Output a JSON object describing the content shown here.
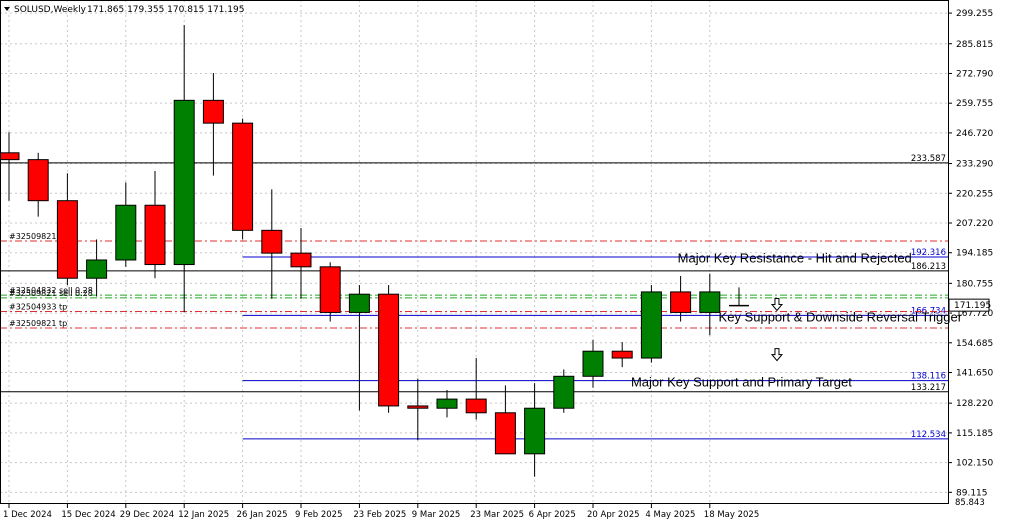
{
  "header": {
    "symbol": "SOLUSD,Weekly",
    "ohlc": "171.865 179.355 170.815 171.195"
  },
  "chart_data": {
    "type": "candlestick",
    "ylim": [
      84,
      305
    ],
    "y_ticks": [
      "299.255",
      "285.815",
      "272.790",
      "259.755",
      "246.720",
      "233.290",
      "220.255",
      "207.220",
      "194.185",
      "180.755",
      "167.720",
      "154.685",
      "141.650",
      "128.220",
      "115.185",
      "102.150",
      "89.115"
    ],
    "x_labels": [
      {
        "label": "1 Dec 2024",
        "index": 0
      },
      {
        "label": "15 Dec 2024",
        "index": 2
      },
      {
        "label": "29 Dec 2024",
        "index": 4
      },
      {
        "label": "12 Jan 2025",
        "index": 6
      },
      {
        "label": "26 Jan 2025",
        "index": 8
      },
      {
        "label": "9 Feb 2025",
        "index": 10
      },
      {
        "label": "23 Feb 2025",
        "index": 12
      },
      {
        "label": "9 Mar 2025",
        "index": 14
      },
      {
        "label": "23 Mar 2025",
        "index": 16
      },
      {
        "label": "6 Apr 2025",
        "index": 18
      },
      {
        "label": "20 Apr 2025",
        "index": 20
      },
      {
        "label": "4 May 2025",
        "index": 22
      },
      {
        "label": "18 May 2025",
        "index": 24
      }
    ],
    "candles": [
      {
        "o": 238,
        "h": 247,
        "l": 217,
        "c": 235
      },
      {
        "o": 235,
        "h": 238,
        "l": 210,
        "c": 217
      },
      {
        "o": 217,
        "h": 229,
        "l": 180,
        "c": 183
      },
      {
        "o": 183,
        "h": 200,
        "l": 175,
        "c": 191
      },
      {
        "o": 191,
        "h": 225,
        "l": 188,
        "c": 215
      },
      {
        "o": 215,
        "h": 230,
        "l": 183,
        "c": 189
      },
      {
        "o": 189,
        "h": 294,
        "l": 168,
        "c": 261
      },
      {
        "o": 261,
        "h": 273,
        "l": 228,
        "c": 251
      },
      {
        "o": 251,
        "h": 253,
        "l": 200,
        "c": 204
      },
      {
        "o": 204,
        "h": 222,
        "l": 174,
        "c": 194
      },
      {
        "o": 194,
        "h": 205,
        "l": 174,
        "c": 188
      },
      {
        "o": 188,
        "h": 190,
        "l": 164,
        "c": 168
      },
      {
        "o": 168,
        "h": 180,
        "l": 125,
        "c": 176
      },
      {
        "o": 176,
        "h": 180,
        "l": 124,
        "c": 127
      },
      {
        "o": 127,
        "h": 139,
        "l": 112,
        "c": 126
      },
      {
        "o": 126,
        "h": 134,
        "l": 122,
        "c": 130
      },
      {
        "o": 130,
        "h": 148,
        "l": 121,
        "c": 124
      },
      {
        "o": 124,
        "h": 136,
        "l": 106,
        "c": 106
      },
      {
        "o": 106,
        "h": 137,
        "l": 96,
        "c": 126
      },
      {
        "o": 126,
        "h": 143,
        "l": 124,
        "c": 140
      },
      {
        "o": 140,
        "h": 156,
        "l": 135,
        "c": 151
      },
      {
        "o": 151,
        "h": 155,
        "l": 144,
        "c": 148
      },
      {
        "o": 148,
        "h": 180,
        "l": 146,
        "c": 177
      },
      {
        "o": 177,
        "h": 184,
        "l": 164,
        "c": 168
      },
      {
        "o": 168,
        "h": 185,
        "l": 158,
        "c": 177
      },
      {
        "o": 172,
        "h": 179,
        "l": 171,
        "c": 171
      }
    ],
    "levels": [
      {
        "value": 233.587,
        "label": "233.587",
        "style": "black",
        "from_index": 0
      },
      {
        "value": 192.316,
        "label": "192.316",
        "style": "blue",
        "from_index": 8
      },
      {
        "value": 186.213,
        "label": "186.213",
        "style": "black",
        "from_index": 0
      },
      {
        "value": 166.734,
        "label": "166.734",
        "style": "blue",
        "from_index": 8
      },
      {
        "value": 138.116,
        "label": "138.116",
        "style": "blue",
        "from_index": 8
      },
      {
        "value": 133.217,
        "label": "133.217",
        "style": "black",
        "from_index": 0
      },
      {
        "value": 112.534,
        "label": "112.534",
        "style": "blue",
        "from_index": 8
      }
    ],
    "orders": [
      {
        "value": 199.3,
        "label": "#32509821",
        "color": "#e03030"
      },
      {
        "value": 175.6,
        "label": "#32504832 sell 0.28",
        "color": "#22aa22"
      },
      {
        "value": 174.4,
        "label": "#32509821 sell 0.28",
        "color": "#22aa22"
      },
      {
        "value": 168.4,
        "label": "#32504933 tp",
        "color": "#e03030"
      },
      {
        "value": 161.2,
        "label": "#32509821 tp",
        "color": "#e03030"
      }
    ],
    "annotations": [
      {
        "text": "Major Key Resistance - Hit and Rejected",
        "value": 189.8,
        "index": 22.9
      },
      {
        "text": "Key Support & Downside Reversal Trigger",
        "value": 164.0,
        "index": 24.3
      },
      {
        "text": "Major Key Support and Primary Target",
        "value": 135.6,
        "index": 21.3
      }
    ],
    "arrows": [
      {
        "index": 26.3,
        "value": 171.5
      },
      {
        "index": 26.3,
        "value": 149.5
      }
    ],
    "current_price": {
      "value": 171.195,
      "label": "171.195"
    },
    "bottom_label": "85.843",
    "colors": {
      "bull": "#008000",
      "bear": "#ff0000",
      "blue_level": "#0000cc",
      "black_level": "#000000",
      "grid": "#c8c8c8"
    }
  }
}
